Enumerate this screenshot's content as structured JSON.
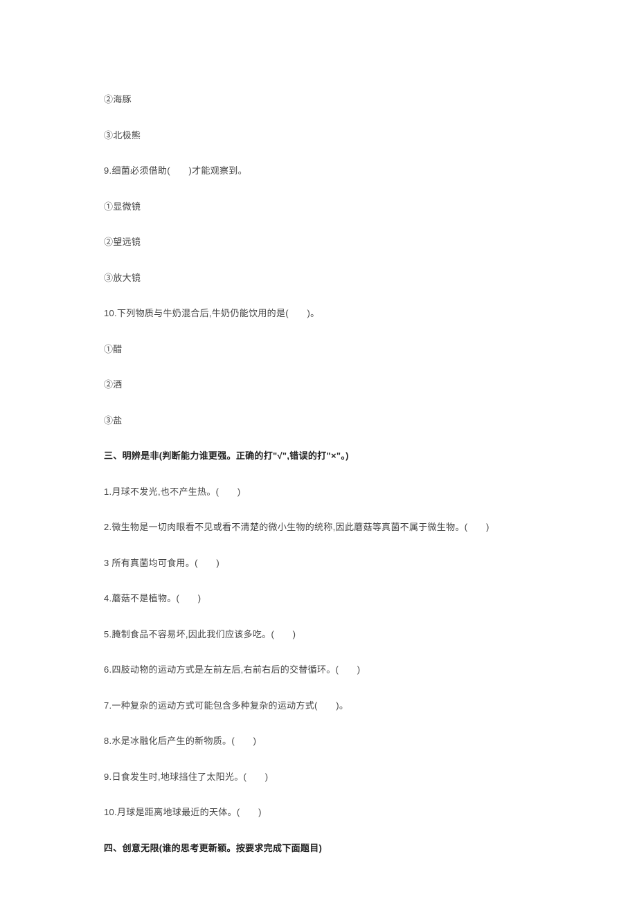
{
  "q8": {
    "opt2": "②海豚",
    "opt3": "③北极熊"
  },
  "q9": {
    "stem": "9.细菌必须借助(　　)才能观察到。",
    "opt1": "①显微镜",
    "opt2": "②望远镜",
    "opt3": "③放大镜"
  },
  "q10": {
    "stem": "10.下列物质与牛奶混合后,牛奶仍能饮用的是(　　)。",
    "opt1": "①醋",
    "opt2": "②酒",
    "opt3": "③盐"
  },
  "section3": {
    "title": "三、明辨是非(判断能力谁更强。正确的打\"√\",错误的打\"×\"。)",
    "items": [
      "1.月球不发光,也不产生热。(　　)",
      "2.微生物是一切肉眼看不见或看不清楚的微小生物的统称,因此蘑菇等真菌不属于微生物。(　　)",
      "3 所有真菌均可食用。(　　)",
      "4.蘑菇不是植物。(　　)",
      "5.腌制食品不容易坏,因此我们应该多吃。(　　)",
      "6.四肢动物的运动方式是左前左后,右前右后的交替循环。(　　)",
      "7.一种复杂的运动方式可能包含多种复杂的运动方式(　　)。",
      "8.水是冰融化后产生的新物质。(　　)",
      "9.日食发生时,地球挡住了太阳光。(　　)",
      "10.月球是距离地球最近的天体。(　　)"
    ]
  },
  "section4": {
    "title": "四、创意无限(谁的思考更新颖。按要求完成下面题目)"
  }
}
